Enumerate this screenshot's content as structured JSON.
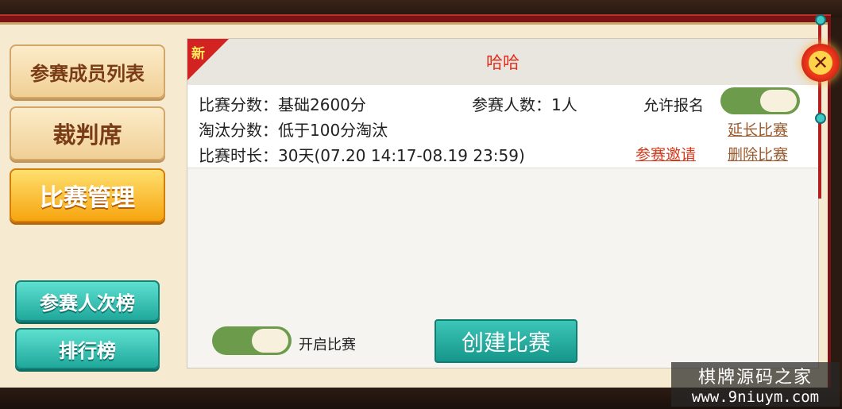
{
  "left_menu": {
    "members_label": "参赛成员列表",
    "referee_label": "裁判席",
    "match_manage_label": "比赛管理",
    "participation_rank_label": "参赛人次榜",
    "ranking_label": "排行榜"
  },
  "match_card": {
    "new_tag": "新",
    "title": "哈哈",
    "score_text": "比赛分数：基础2600分",
    "participants_text": "参赛人数：1人",
    "allow_signup_label": "允许报名",
    "allow_signup_on": true,
    "eliminate_text": "淘汰分数：低于100分淘汰",
    "duration_text": "比赛时长：30天(07.20 14:17-08.19 23:59)",
    "extend_link": "延长比赛",
    "invite_link": "参赛邀请",
    "delete_link": "删除比赛"
  },
  "footer": {
    "open_match_label": "开启比赛",
    "open_match_on": true,
    "create_match_button": "创建比赛"
  },
  "close_button": "✕",
  "watermark": {
    "line1": "棋牌源码之家",
    "line2": "www.9niuym.com"
  },
  "colors": {
    "title_red": "#e0301e",
    "link_red": "#d43a1c",
    "link_brown": "#9a5a2e",
    "toggle_green": "#6c9b4b",
    "teal_button": "#1fa89b",
    "active_orange": "#f6a50f"
  }
}
